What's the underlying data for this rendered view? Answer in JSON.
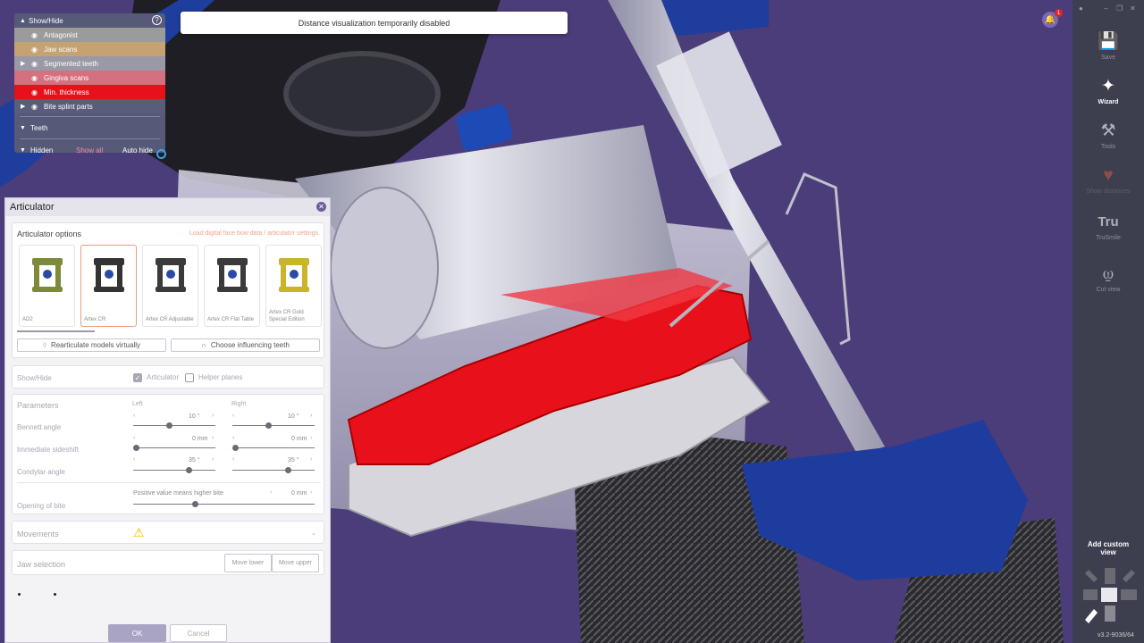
{
  "banner": {
    "text": "Distance visualization temporarily disabled"
  },
  "notifications": {
    "count": "1"
  },
  "showhide": {
    "title": "Show/Hide",
    "help": "?",
    "items": [
      {
        "label": "Antagonist",
        "color": "#9b9b9b"
      },
      {
        "label": "Jaw scans",
        "color": "#c4a271"
      },
      {
        "label": "Segmented teeth",
        "color": "#9a9aa6"
      },
      {
        "label": "Gingiva scans",
        "color": "#d4707f"
      },
      {
        "label": "Min. thickness",
        "color": "#e8101a"
      },
      {
        "label": "Bite splint parts",
        "color": "#595c7a"
      }
    ],
    "teeth": "Teeth",
    "hidden": "Hidden",
    "show_all": "Show all",
    "auto_hide": "Auto hide"
  },
  "articulator": {
    "title": "Articulator",
    "options_title": "Articulator options",
    "load_link": "Load digital face bow data / articulator settings",
    "models": [
      {
        "name": "AD2",
        "selected": false
      },
      {
        "name": "Artex CR",
        "selected": true
      },
      {
        "name": "Artex CR Adjustable",
        "selected": false
      },
      {
        "name": "Artex CR Flat Table",
        "selected": false
      },
      {
        "name": "Artex CR Gold Special Edition",
        "selected": false
      }
    ],
    "rearticulate": "Rearticulate models virtually",
    "influencing": "Choose influencing teeth",
    "show_hide": "Show/Hide",
    "articulator_chk": "Articulator",
    "helper_chk": "Helper planes",
    "parameters": "Parameters",
    "left": "Left",
    "right": "Right",
    "bennett": "Bennett angle",
    "sideshift": "Immediate sideshift",
    "condylar": "Condylar angle",
    "bennett_left": "10 °",
    "bennett_right": "10 °",
    "sideshift_left": "0 mm",
    "sideshift_right": "0 mm",
    "condylar_left": "35 °",
    "condylar_right": "35 °",
    "opening_hint": "Positive value means higher bite",
    "opening": "Opening of bite",
    "opening_val": "0 mm",
    "movements": "Movements",
    "jaw_selection": "Jaw selection",
    "move_lower": "Move lower",
    "move_upper": "Move upper",
    "ok": "OK",
    "cancel": "Cancel"
  },
  "toolbar": {
    "save": "Save",
    "wizard": "Wizard",
    "tools": "Tools",
    "show_distances": "Show distances",
    "trusmile": "TruSmile",
    "tru_logo": "Tru",
    "cut_view": "Cut view",
    "add_view": "Add custom view"
  },
  "version": "v3.2-9036/64",
  "colors": {
    "accent": "#6c5d9c",
    "splint_red": "#e8101a",
    "viewport_bg": "#4b3c7a"
  }
}
